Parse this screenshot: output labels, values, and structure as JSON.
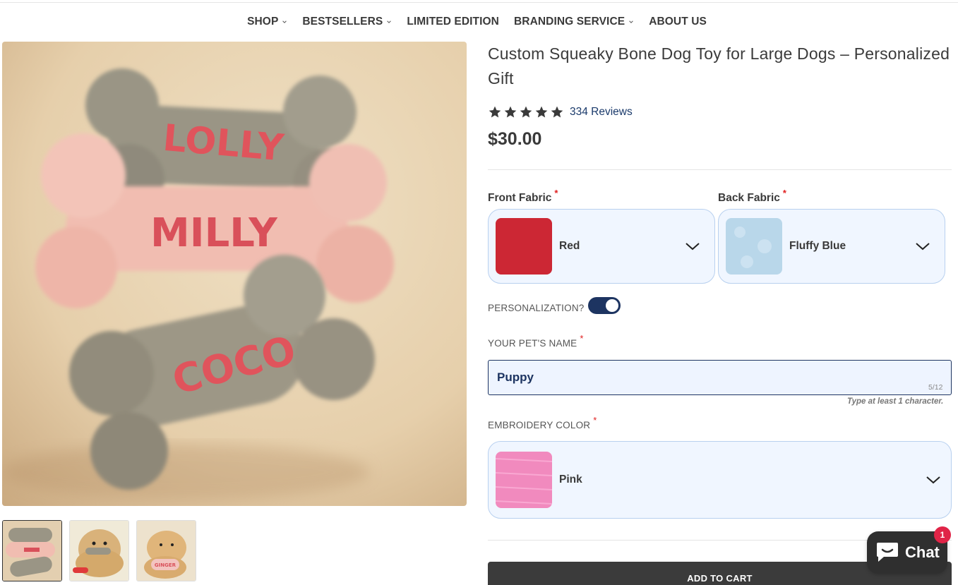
{
  "nav": {
    "items": [
      {
        "label": "SHOP",
        "dropdown": true
      },
      {
        "label": "BESTSELLERS",
        "dropdown": true
      },
      {
        "label": "LIMITED EDITION",
        "dropdown": false
      },
      {
        "label": "BRANDING SERVICE",
        "dropdown": true
      },
      {
        "label": "ABOUT US",
        "dropdown": false
      }
    ]
  },
  "gallery": {
    "main_image_words": [
      "LOLLY",
      "MILLY",
      "COCO"
    ],
    "thumb_label": "GINGER"
  },
  "product": {
    "title": "Custom Squeaky Bone Dog Toy for Large Dogs – Personalized Gift",
    "rating": 5,
    "reviews": "334 Reviews",
    "price": "$30.00"
  },
  "options": {
    "front_fabric": {
      "label": "Front Fabric",
      "value": "Red",
      "color": "#d42a37"
    },
    "back_fabric": {
      "label": "Back Fabric",
      "value": "Fluffy Blue",
      "color": "#b9d7ea"
    },
    "personalization": {
      "label": "PERSONALIZATION?",
      "enabled": true
    },
    "pet_name": {
      "label": "YOUR PET'S NAME",
      "value": "Puppy",
      "counter": "5/12",
      "hint": "Type at least 1 character."
    },
    "embroidery_color": {
      "label": "EMBROIDERY COLOR",
      "value": "Pink",
      "color": "#f07ab5"
    },
    "required_mark": "*"
  },
  "cart": {
    "add_to_cart": "ADD TO CART"
  },
  "chat": {
    "label": "Chat",
    "badge": "1"
  },
  "colors": {
    "accent": "#1d3461",
    "text": "#3a3a3a",
    "select_bg": "#f0f6ff",
    "select_border": "#b8d0ef"
  }
}
